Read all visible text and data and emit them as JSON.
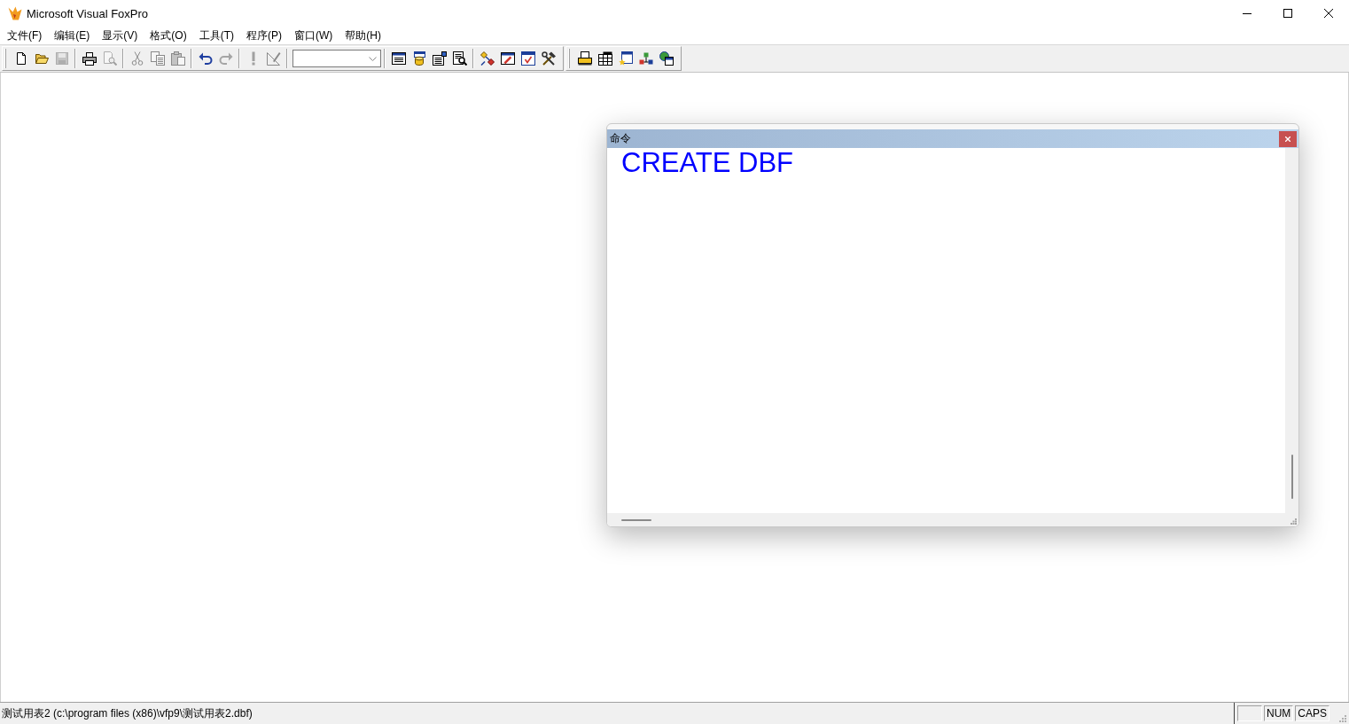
{
  "window": {
    "title": "Microsoft Visual FoxPro"
  },
  "menu": [
    "文件(F)",
    "编辑(E)",
    "显示(V)",
    "格式(O)",
    "工具(T)",
    "程序(P)",
    "窗口(W)",
    "帮助(H)"
  ],
  "toolbars": [
    {
      "groups": [
        [
          {
            "kind": "new",
            "disabled": false
          },
          {
            "kind": "open",
            "disabled": false
          },
          {
            "kind": "save",
            "disabled": true
          }
        ],
        [
          {
            "kind": "print",
            "disabled": false
          },
          {
            "kind": "preview",
            "disabled": true
          }
        ],
        [
          {
            "kind": "cut",
            "disabled": true
          },
          {
            "kind": "copy",
            "disabled": true
          },
          {
            "kind": "paste",
            "disabled": true
          }
        ],
        [
          {
            "kind": "undo",
            "disabled": false
          },
          {
            "kind": "redo",
            "disabled": true
          }
        ],
        [
          {
            "kind": "run",
            "disabled": true
          },
          {
            "kind": "modify",
            "disabled": true
          }
        ],
        [
          {
            "kind": "combo"
          }
        ],
        [
          {
            "kind": "command",
            "disabled": false
          },
          {
            "kind": "datasession",
            "disabled": false
          },
          {
            "kind": "properties",
            "disabled": false
          },
          {
            "kind": "code",
            "disabled": false
          }
        ],
        [
          {
            "kind": "diagram",
            "disabled": false
          },
          {
            "kind": "edit",
            "disabled": false
          },
          {
            "kind": "window",
            "disabled": false
          },
          {
            "kind": "tools",
            "disabled": false
          }
        ]
      ]
    },
    {
      "groups": [
        [
          {
            "kind": "report",
            "disabled": false
          },
          {
            "kind": "table",
            "disabled": false
          },
          {
            "kind": "wizard",
            "disabled": false
          },
          {
            "kind": "classes",
            "disabled": false
          },
          {
            "kind": "gallery",
            "disabled": false
          }
        ]
      ]
    }
  ],
  "command_window": {
    "title": "命令",
    "lines": [
      "CREATE DBF"
    ]
  },
  "status_bar": {
    "text": "测试用表2 (c:\\program files (x86)\\vfp9\\测试用表2.dbf)",
    "indicators": [
      "NUM",
      "CAPS"
    ]
  }
}
